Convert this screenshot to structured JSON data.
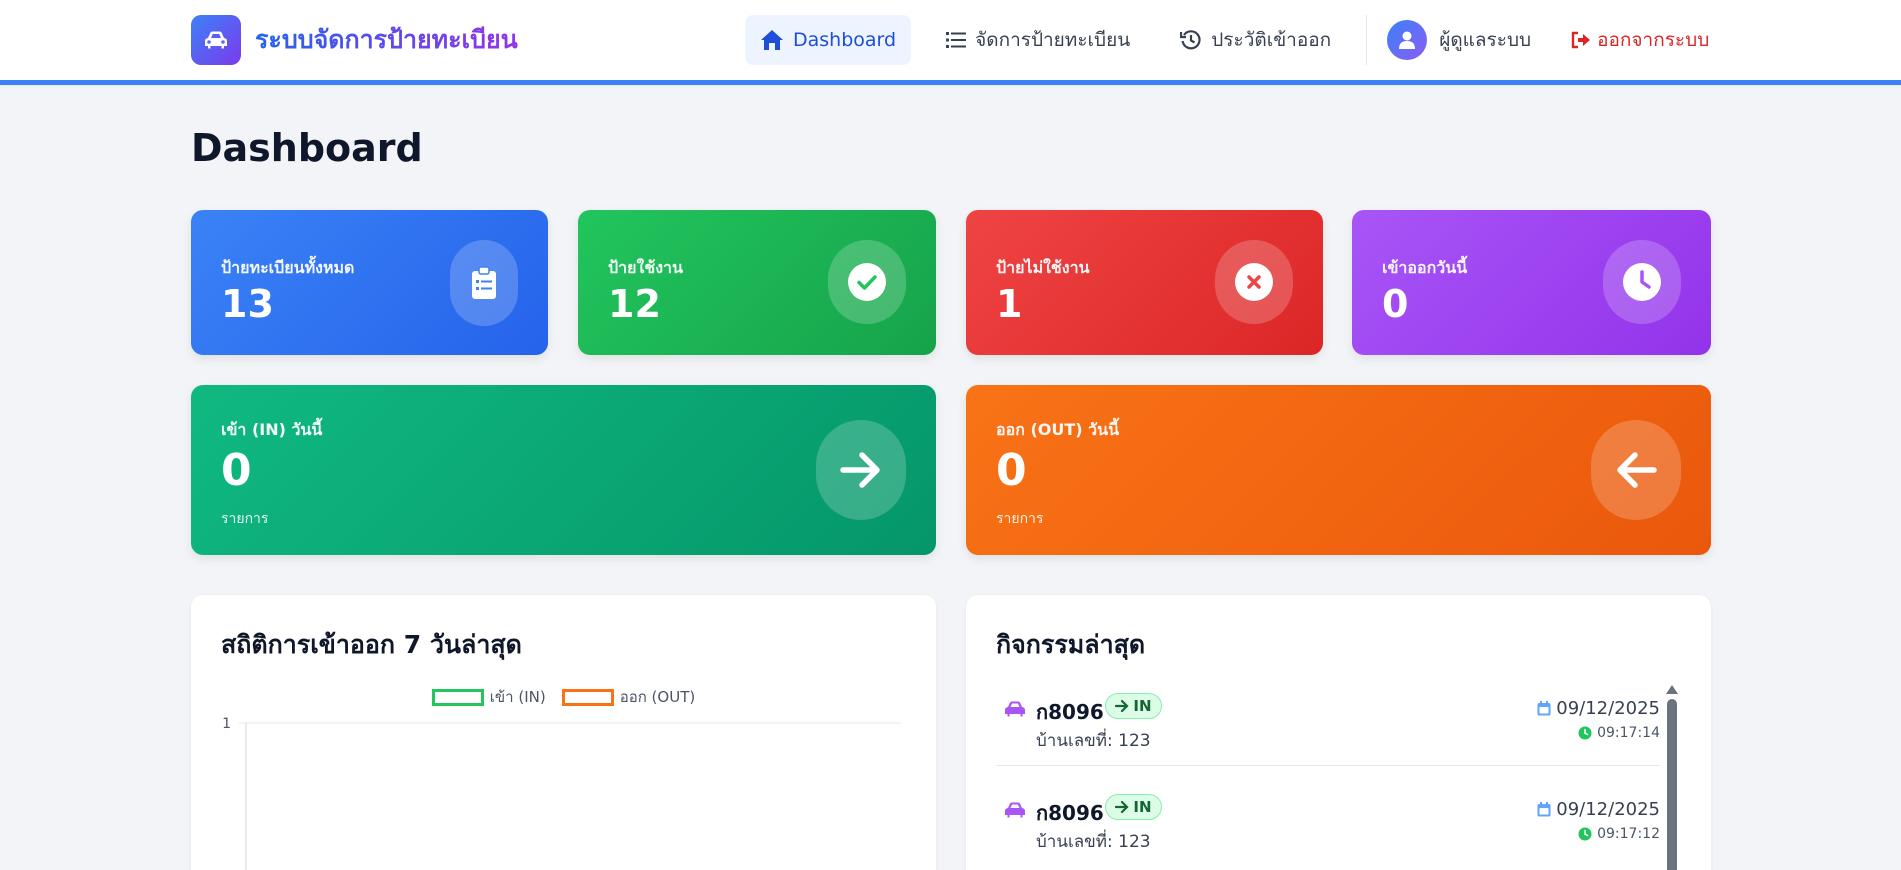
{
  "brand": {
    "title": "ระบบจัดการป้ายทะเบียน"
  },
  "nav": {
    "items": [
      {
        "label": "Dashboard",
        "icon": "home-icon",
        "active": true
      },
      {
        "label": "จัดการป้ายทะเบียน",
        "icon": "list-icon"
      },
      {
        "label": "ประวัติเข้าออก",
        "icon": "history-icon"
      }
    ],
    "user": "ผู้ดูแลระบบ",
    "logout": "ออกจากระบบ"
  },
  "page_title": "Dashboard",
  "stats": [
    {
      "label": "ป้ายทะเบียนทั้งหมด",
      "value": "13",
      "icon": "clipboard-list-icon",
      "color": "#3b82f6"
    },
    {
      "label": "ป้ายใช้งาน",
      "value": "12",
      "icon": "check-circle-icon",
      "color": "#22c55e"
    },
    {
      "label": "ป้ายไม่ใช้งาน",
      "value": "1",
      "icon": "x-circle-icon",
      "color": "#ef4444"
    },
    {
      "label": "เข้าออกวันนี้",
      "value": "0",
      "icon": "clock-icon",
      "color": "#a855f7"
    }
  ],
  "today": [
    {
      "label": "เข้า (IN) วันนี้",
      "value": "0",
      "unit": "รายการ",
      "icon": "arrow-right-icon",
      "color": "#10b981"
    },
    {
      "label": "ออก (OUT) วันนี้",
      "value": "0",
      "unit": "รายการ",
      "icon": "arrow-left-icon",
      "color": "#f97316"
    }
  ],
  "chart_panel": {
    "title": "สถิติการเข้าออก 7 วันล่าสุด",
    "legend": [
      {
        "label": "เข้า (IN)",
        "color": "#22c55e"
      },
      {
        "label": "ออก (OUT)",
        "color": "#f97316"
      }
    ]
  },
  "chart_data": {
    "type": "line",
    "title": "",
    "series": [
      {
        "name": "เข้า (IN)",
        "values": []
      },
      {
        "name": "ออก (OUT)",
        "values": []
      }
    ],
    "y_ticks": [
      "1"
    ],
    "legend_position": "top"
  },
  "activity": {
    "title": "กิจกรรมล่าสุด",
    "items": [
      {
        "plate": "ก8096",
        "direction": "IN",
        "house_label": "บ้านเลขที่:",
        "house": "123",
        "date": "09/12/2025",
        "time": "09:17:14"
      },
      {
        "plate": "ก8096",
        "direction": "IN",
        "house_label": "บ้านเลขที่:",
        "house": "123",
        "date": "09/12/2025",
        "time": "09:17:12"
      }
    ]
  }
}
